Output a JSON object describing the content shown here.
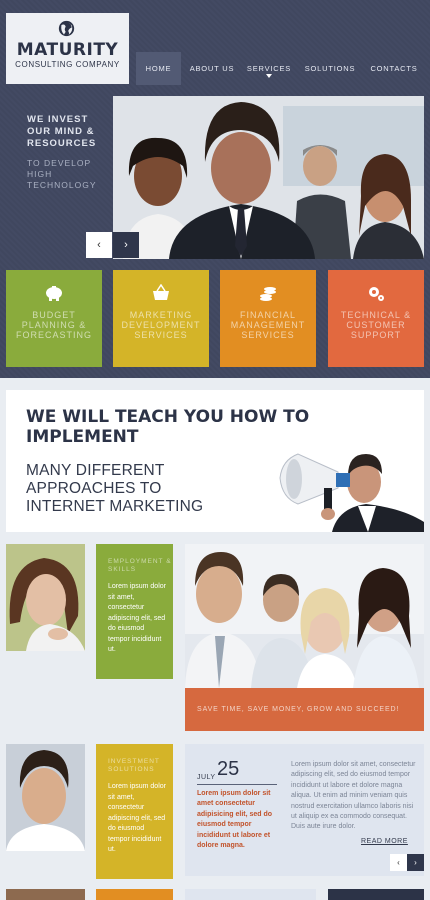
{
  "brand": {
    "name": "MATURITY",
    "tagline": "CONSULTING COMPANY"
  },
  "nav": {
    "items": [
      "HOME",
      "ABOUT US",
      "SERVICES",
      "SOLUTIONS",
      "CONTACTS"
    ],
    "active": "HOME"
  },
  "slider": {
    "caption_bold": "WE INVEST OUR MIND & RESOURCES",
    "caption_light": "TO DEVELOP HIGH TECHNOLOGY",
    "prev_icon": "‹",
    "next_icon": "›"
  },
  "services": [
    {
      "label": "BUDGET PLANNING & FORECASTING",
      "icon": "piggy-bank-icon",
      "color": "#8aab3c"
    },
    {
      "label": "MARKETING DEVELOPMENT SERVICES",
      "icon": "basket-icon",
      "color": "#d4b428"
    },
    {
      "label": "FINANCIAL MANAGEMENT SERVICES",
      "icon": "coins-icon",
      "color": "#e28e22"
    },
    {
      "label": "TECHNICAL & CUSTOMER SUPPORT",
      "icon": "gears-icon",
      "color": "#e2693f"
    }
  ],
  "promo": {
    "heading": "WE WILL TEACH YOU HOW TO IMPLEMENT",
    "subheading": "MANY DIFFERENT APPROACHES TO INTERNET MARKETING"
  },
  "cards": [
    {
      "title": "EMPLOYMENT & SKILLS",
      "text": "Lorem ipsum dolor sit amet, consectetur adipiscing elit, sed do eiusmod tempor incididunt ut."
    },
    {
      "title": "INVESTMENT SOLUTIONS",
      "text": "Lorem ipsum dolor sit amet, consectetur adipiscing elit, sed do eiusmod tempor incididunt ut."
    }
  ],
  "banner": {
    "text": "SAVE TIME, SAVE MONEY, GROW AND SUCCEED!"
  },
  "news": {
    "month": "JULY",
    "day": "25",
    "highlight": "Lorem ipsum dolor sit amet consectetur adipisicing elit, sed do eiusmod tempor incididunt ut labore et dolore magna.",
    "body": "Lorem ipsum dolor sit amet, consectetur adipiscing elit, sed do eiusmod tempor incididunt ut labore et dolore magna aliqua. Ut enim ad minim veniam quis nostrud exercitation ullamco laboris nisi ut aliquip ex ea commodo consequat. Duis aute irure dolor.",
    "read_more": "READ MORE",
    "prev_icon": "‹",
    "next_icon": "›"
  },
  "colors": {
    "header_bg": "#434a63",
    "green": "#8aab3c",
    "yellow": "#d4b428",
    "orange": "#e28e22",
    "coral": "#e2693f",
    "navy": "#2c3347",
    "news_red": "#c2532b"
  }
}
